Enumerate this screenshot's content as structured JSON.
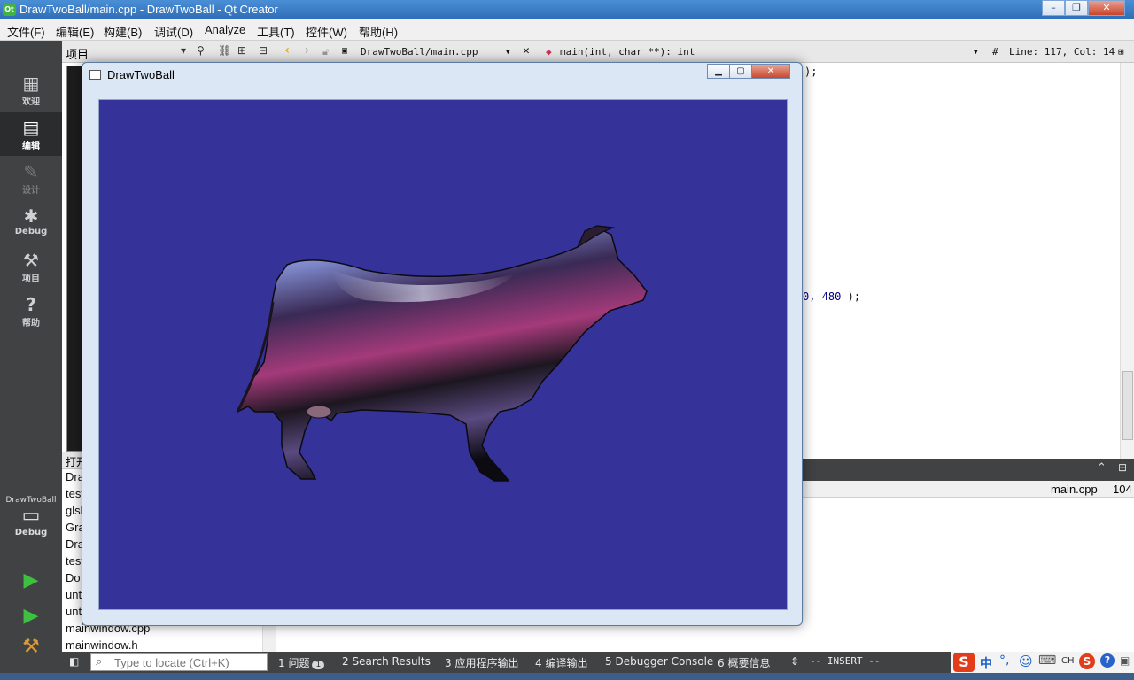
{
  "window": {
    "title": "DrawTwoBall/main.cpp - DrawTwoBall - Qt Creator",
    "app_icon": "Qt"
  },
  "menu": [
    "文件(F)",
    "编辑(E)",
    "构建(B)",
    "调试(D)",
    "Analyze",
    "工具(T)",
    "控件(W)",
    "帮助(H)"
  ],
  "modes": [
    {
      "label": "欢迎",
      "icon": "grid-icon"
    },
    {
      "label": "编辑",
      "icon": "edit-icon"
    },
    {
      "label": "设计",
      "icon": "pen-icon"
    },
    {
      "label": "Debug",
      "icon": "bug-icon"
    },
    {
      "label": "项目",
      "icon": "wrench-icon"
    },
    {
      "label": "帮助",
      "icon": "help-icon"
    }
  ],
  "kit": {
    "project": "DrawTwoBall",
    "config": "Debug"
  },
  "navigator": {
    "title": "项目",
    "open_docs_header": "打开文档"
  },
  "open_documents": [
    "DrawTwoBall",
    "test",
    "glsl",
    "Gra",
    "Draw",
    "test",
    "Do",
    "unt",
    "unt",
    "mainwindow.cpp",
    "mainwindow.h"
  ],
  "editor_toolbar": {
    "file": "DrawTwoBall/main.cpp",
    "symbol": "main(int, char **): int",
    "hash": "#",
    "position": "Line: 117, Col: 14"
  },
  "code": {
    "line1": ");",
    "line2_a": "0, ",
    "line2_num": "480",
    "line2_b": " );"
  },
  "output": {
    "file": "main.cpp",
    "line": "104"
  },
  "locator": {
    "placeholder": "Type to locate (Ctrl+K)"
  },
  "panes": [
    {
      "num": "1",
      "label": "问题",
      "badge": "1"
    },
    {
      "num": "2",
      "label": "Search Results"
    },
    {
      "num": "3",
      "label": "应用程序输出"
    },
    {
      "num": "4",
      "label": "编译输出"
    },
    {
      "num": "5",
      "label": "Debugger Console"
    },
    {
      "num": "6",
      "label": "概要信息"
    }
  ],
  "vim_mode": "-- INSERT --",
  "ime": {
    "lang": "中",
    "ch": "CH"
  },
  "app": {
    "title": "DrawTwoBall"
  },
  "colors": {
    "gl_background": "#35329a",
    "mode_bar": "#404244",
    "accent": "#2f6db5"
  }
}
